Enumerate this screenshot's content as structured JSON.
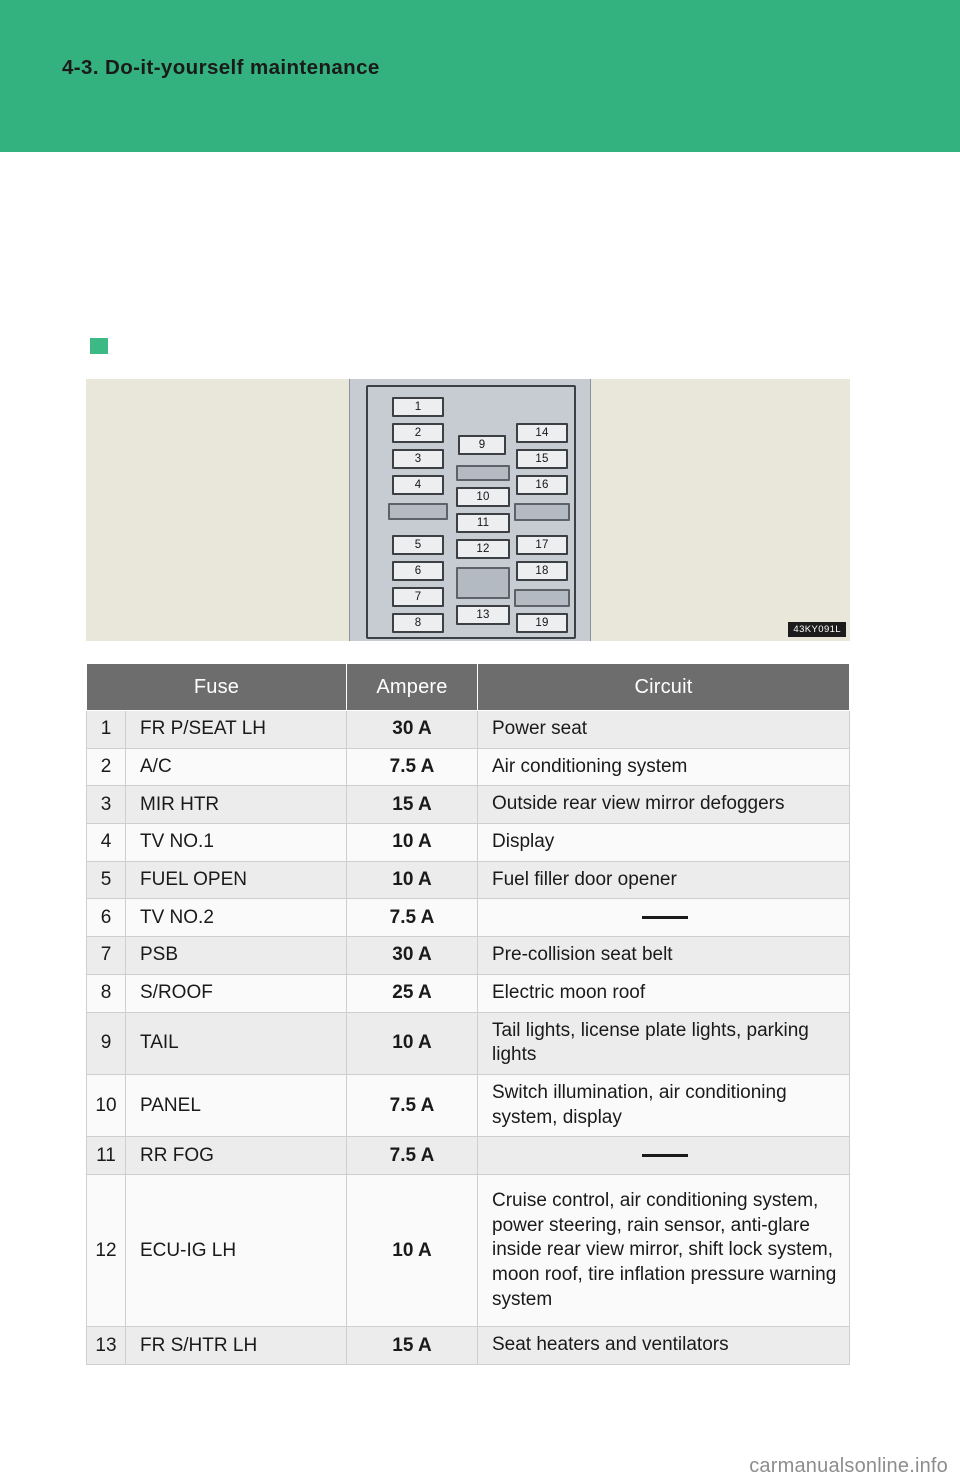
{
  "header": {
    "title": "4-3. Do-it-yourself maintenance"
  },
  "illustration": {
    "image_code": "43KY091L",
    "fuse_labels": [
      "1",
      "2",
      "3",
      "4",
      "5",
      "6",
      "7",
      "8",
      "9",
      "10",
      "11",
      "12",
      "13",
      "14",
      "15",
      "16",
      "17",
      "18",
      "19"
    ]
  },
  "footer": {
    "watermark": "carmanualsonline.info"
  },
  "table": {
    "headers": {
      "fuse": "Fuse",
      "ampere": "Ampere",
      "circuit": "Circuit"
    },
    "rows": [
      {
        "num": "1",
        "fuse": "FR P/SEAT LH",
        "ampere": "30 A",
        "circuit": "Power seat"
      },
      {
        "num": "2",
        "fuse": "A/C",
        "ampere": "7.5 A",
        "circuit": "Air conditioning system"
      },
      {
        "num": "3",
        "fuse": "MIR HTR",
        "ampere": "15 A",
        "circuit": "Outside rear view mirror defoggers"
      },
      {
        "num": "4",
        "fuse": "TV NO.1",
        "ampere": "10 A",
        "circuit": "Display"
      },
      {
        "num": "5",
        "fuse": "FUEL OPEN",
        "ampere": "10 A",
        "circuit": "Fuel filler door opener"
      },
      {
        "num": "6",
        "fuse": "TV NO.2",
        "ampere": "7.5 A",
        "circuit": "—"
      },
      {
        "num": "7",
        "fuse": "PSB",
        "ampere": "30 A",
        "circuit": "Pre-collision seat belt"
      },
      {
        "num": "8",
        "fuse": "S/ROOF",
        "ampere": "25 A",
        "circuit": "Electric moon roof"
      },
      {
        "num": "9",
        "fuse": "TAIL",
        "ampere": "10 A",
        "circuit": "Tail lights, license plate lights, parking lights"
      },
      {
        "num": "10",
        "fuse": "PANEL",
        "ampere": "7.5 A",
        "circuit": "Switch illumination, air conditioning system, display"
      },
      {
        "num": "11",
        "fuse": "RR FOG",
        "ampere": "7.5 A",
        "circuit": "—"
      },
      {
        "num": "12",
        "fuse": "ECU-IG LH",
        "ampere": "10 A",
        "circuit": "Cruise control, air conditioning system, power steering, rain sensor, anti-glare inside rear view mirror, shift lock system, moon roof, tire inflation pressure warning system"
      },
      {
        "num": "13",
        "fuse": "FR S/HTR LH",
        "ampere": "15 A",
        "circuit": "Seat heaters and ventilators"
      }
    ]
  }
}
